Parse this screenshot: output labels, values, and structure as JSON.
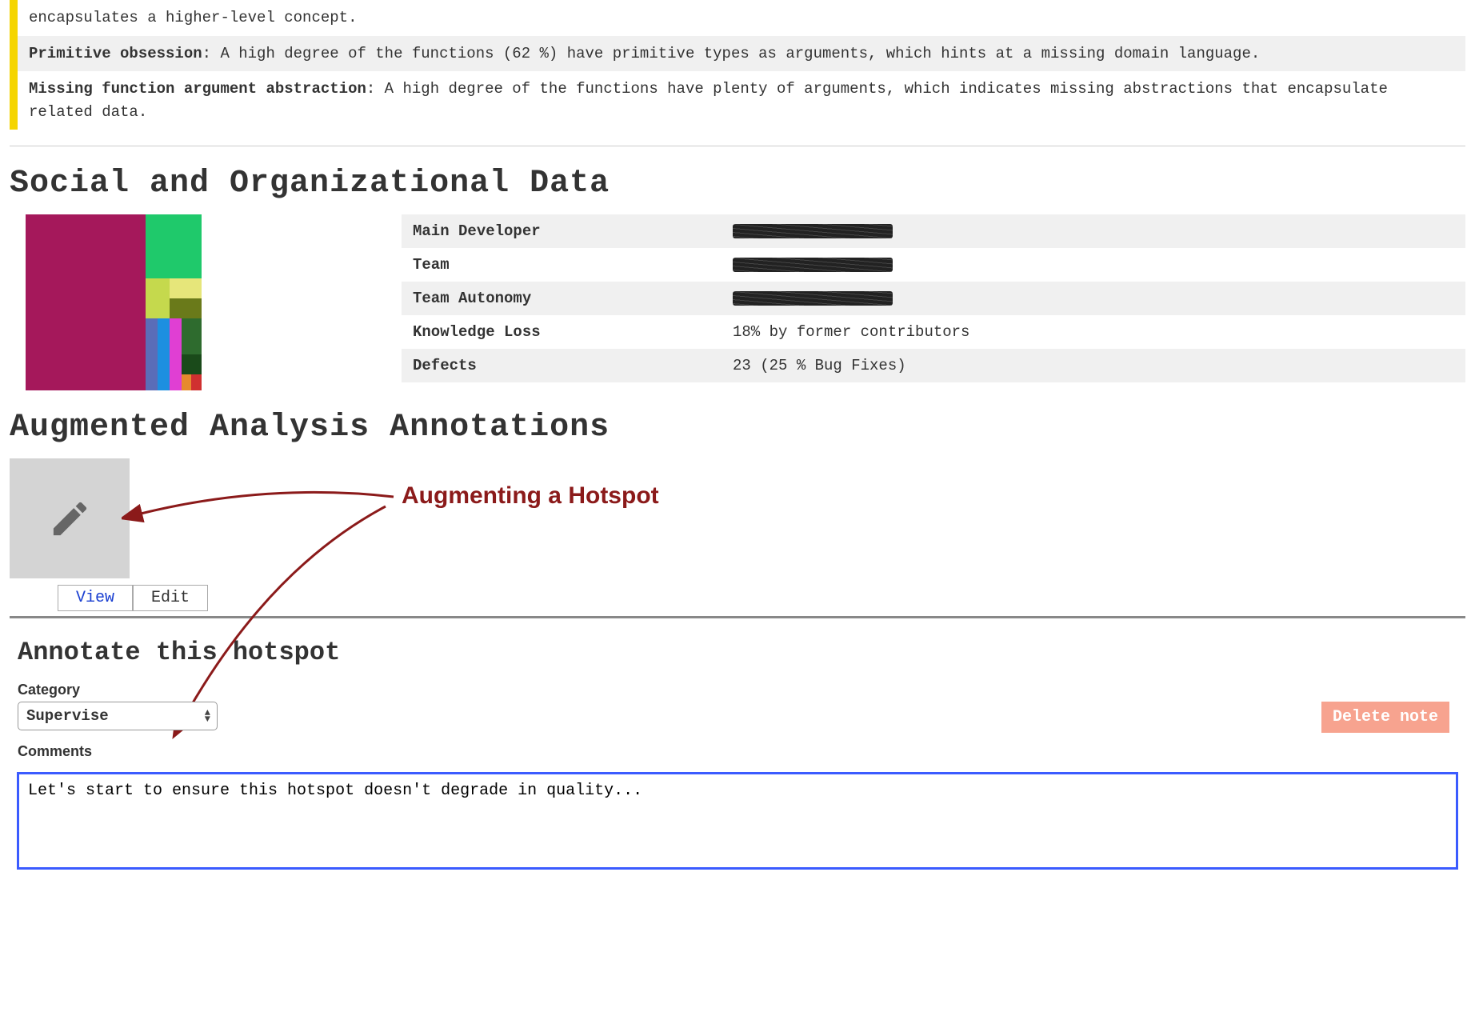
{
  "warnings": [
    {
      "label_a": "",
      "text_a": "encapsulates a higher-level concept."
    },
    {
      "label_b": "Primitive obsession",
      "text_b": ": A high degree of the functions (62 %) have primitive types as arguments, which hints at a missing domain language."
    },
    {
      "label_c": "Missing function argument abstraction",
      "text_c": ": A high degree of the functions have plenty of arguments, which indicates missing abstractions that encapsulate related data."
    }
  ],
  "social": {
    "heading": "Social and Organizational Data",
    "rows": {
      "main_dev_label": "Main Developer",
      "team_label": "Team",
      "autonomy_label": "Team Autonomy",
      "loss_label": "Knowledge Loss",
      "loss_value": "18% by former contributors",
      "defects_label": "Defects",
      "defects_value": "23 (25 % Bug Fixes)"
    }
  },
  "annotations": {
    "heading": "Augmented Analysis Annotations",
    "callout": "Augmenting a Hotspot",
    "tabs": {
      "view": "View",
      "edit": "Edit"
    }
  },
  "form": {
    "heading": "Annotate this hotspot",
    "category_label": "Category",
    "category_value": "Supervise",
    "delete_label": "Delete note",
    "comments_label": "Comments",
    "comments_value": "Let's start to ensure this hotspot doesn't degrade in quality..."
  }
}
